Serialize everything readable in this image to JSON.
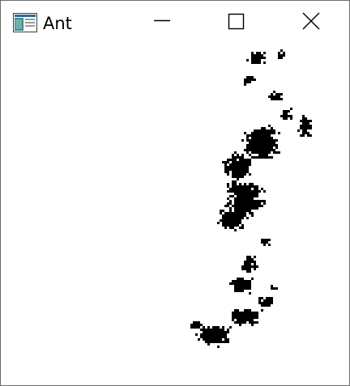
{
  "window": {
    "title": "Ant",
    "app_icon": "window-app-icon",
    "controls": {
      "minimize_icon": "minimize-icon",
      "maximize_icon": "maximize-icon",
      "close_icon": "close-icon"
    }
  },
  "colors": {
    "background": "#ffffff",
    "trail": "#000000",
    "border": "#6b6b6b"
  }
}
